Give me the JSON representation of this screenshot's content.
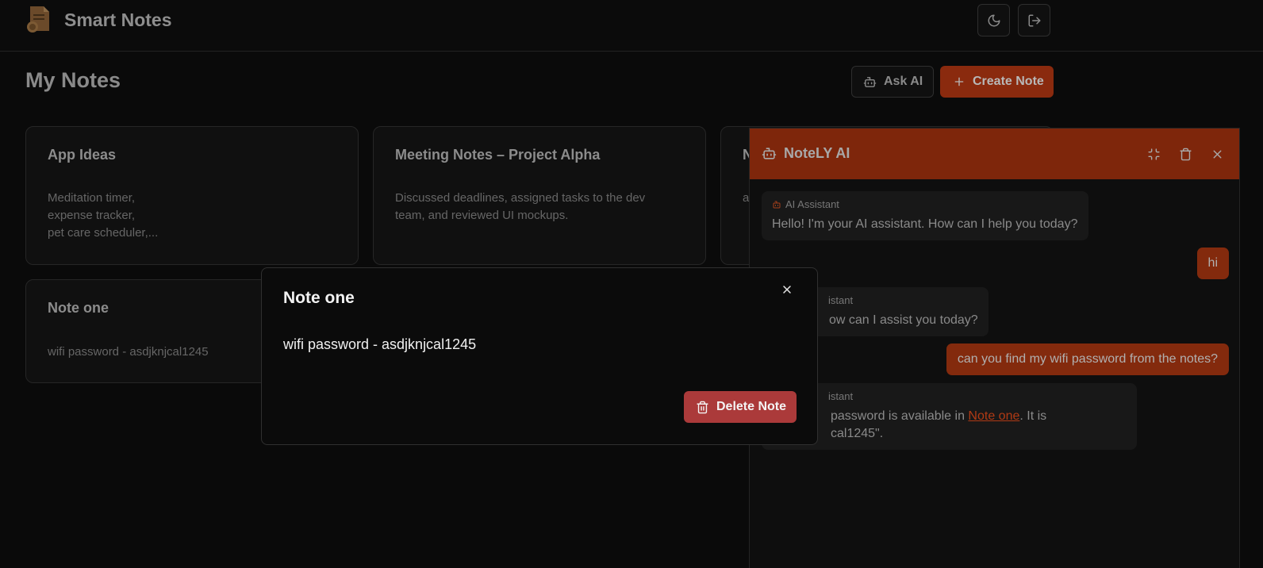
{
  "header": {
    "app_title": "Smart Notes",
    "logo_icon": "notes-logo-icon",
    "theme_icon": "moon-icon",
    "logout_icon": "logout-icon"
  },
  "page": {
    "title": "My Notes",
    "ask_ai_label": "Ask AI",
    "create_note_label": "Create Note"
  },
  "notes": [
    {
      "title": "App Ideas",
      "body": "Meditation timer,\nexpense tracker,\npet care scheduler,..."
    },
    {
      "title": "Meeting Notes – Project Alpha",
      "body": "Discussed deadlines, assigned tasks to the dev\nteam, and reviewed UI mockups."
    },
    {
      "title": "N",
      "body": "a"
    },
    {
      "title": "Note one",
      "body": "wifi password - asdjknjcal1245"
    }
  ],
  "chat": {
    "title": "NoteLY AI",
    "messages": [
      {
        "role": "assistant",
        "sender": "AI Assistant",
        "text": "Hello! I'm your AI assistant. How can I help you today?"
      },
      {
        "role": "user",
        "text": "hi"
      },
      {
        "role": "assistant",
        "sender": "istant",
        "text": "ow can I assist you today?"
      },
      {
        "role": "user",
        "text": "can you find my wifi password from the notes?"
      },
      {
        "role": "assistant",
        "sender": "istant",
        "text_before": "password is available in ",
        "link": "Note one",
        "text_after": ". It is",
        "text_line2": "cal1245\"."
      }
    ]
  },
  "modal": {
    "title": "Note one",
    "content": "wifi password - asdjknjcal1245",
    "delete_label": "Delete Note"
  },
  "colors": {
    "accent": "#8a2a0e",
    "danger": "#ab3a3a",
    "background": "#0a0a0a"
  }
}
